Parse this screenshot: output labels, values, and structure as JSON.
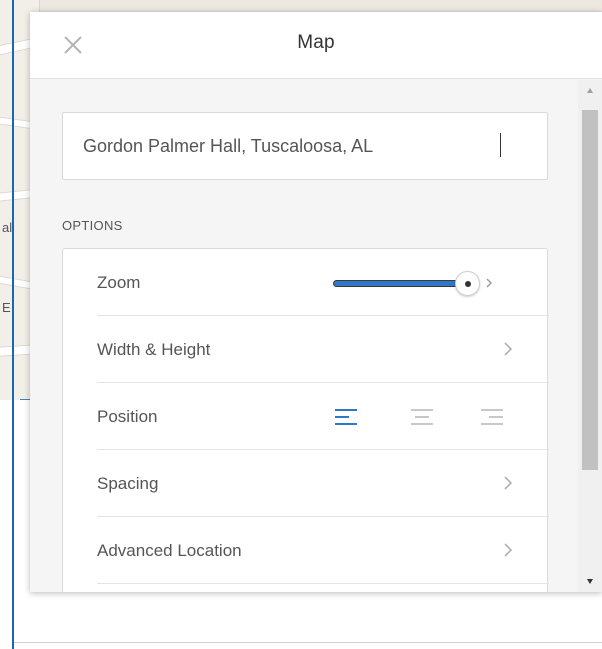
{
  "map_background": {
    "fragments": [
      "al",
      "E"
    ]
  },
  "panel": {
    "title": "Map",
    "location": {
      "value": "Gordon Palmer Hall, Tuscaloosa, AL"
    },
    "options_header": "OPTIONS",
    "options": [
      {
        "label": "Zoom"
      },
      {
        "label": "Width & Height"
      },
      {
        "label": "Position"
      },
      {
        "label": "Spacing"
      },
      {
        "label": "Advanced Location"
      }
    ],
    "zoom_level_fraction": 0.9,
    "position_selected": "left"
  },
  "icons": {
    "close": "close-icon",
    "chevron": "chevron-right-icon",
    "align_left": "align-left-icon",
    "align_center": "align-center-icon",
    "align_right": "align-right-icon"
  },
  "colors": {
    "accent": "#2f78c8",
    "selected_align": "#2f78c8",
    "unselected_align": "#c8c8c8"
  }
}
